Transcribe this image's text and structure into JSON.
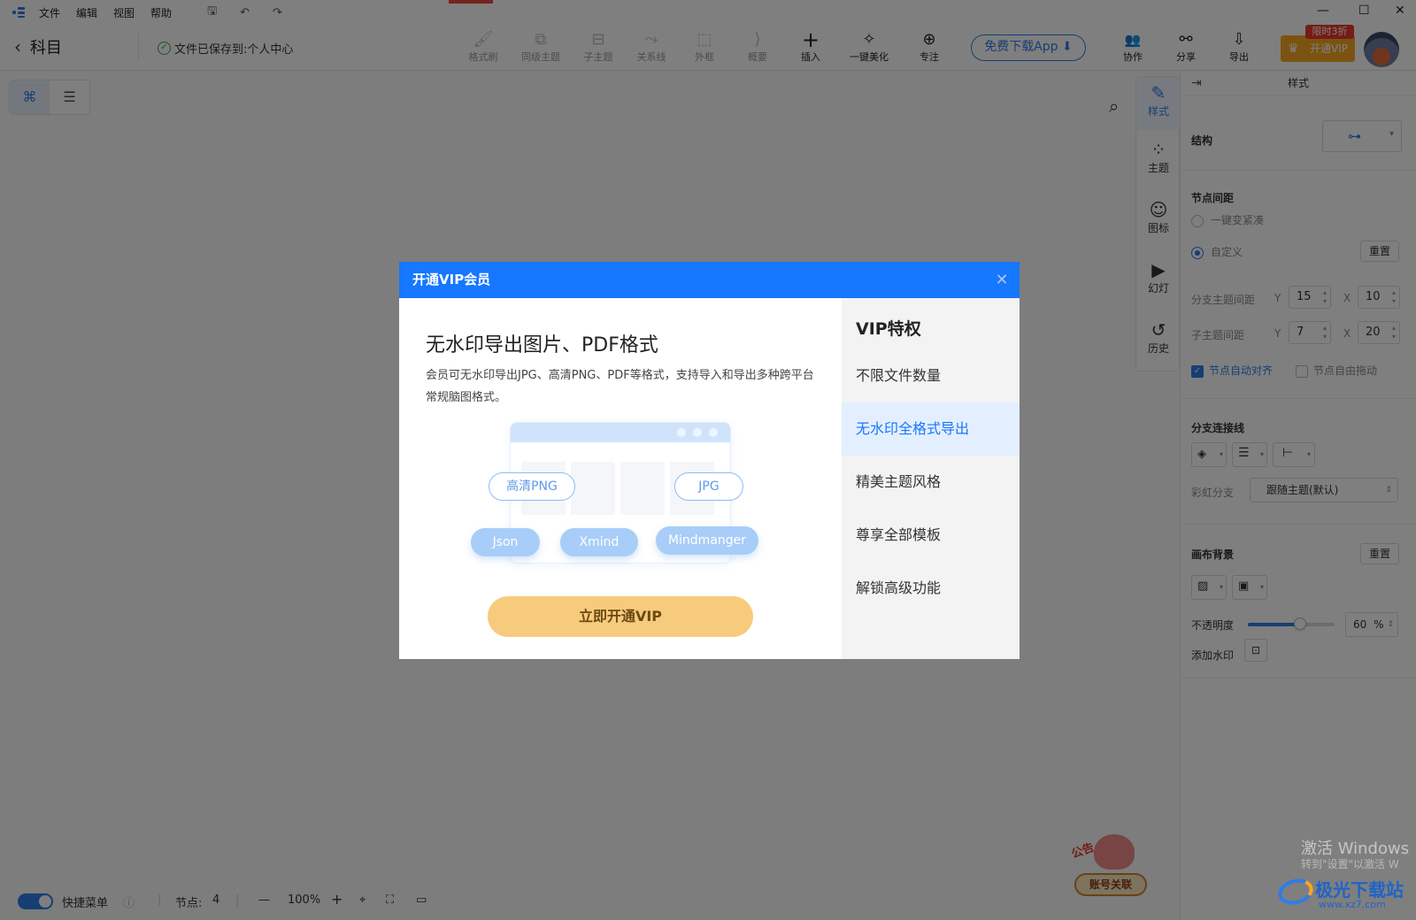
{
  "menu": {
    "items": [
      "文件",
      "编辑",
      "视图",
      "帮助"
    ]
  },
  "header": {
    "back_label": "科目",
    "saved_status": "文件已保存到:个人中心"
  },
  "toolbar": {
    "tools": [
      {
        "label": "格式刷",
        "icon": "format-brush-icon",
        "glyph": "🖌"
      },
      {
        "label": "同级主题",
        "icon": "sibling-topic-icon",
        "glyph": "⧉"
      },
      {
        "label": "子主题",
        "icon": "subtopic-icon",
        "glyph": "⊟"
      },
      {
        "label": "关系线",
        "icon": "relation-line-icon",
        "glyph": "⤳"
      },
      {
        "label": "外框",
        "icon": "boundary-icon",
        "glyph": "⬚"
      },
      {
        "label": "概要",
        "icon": "summary-icon",
        "glyph": "⟩"
      },
      {
        "label": "插入",
        "icon": "insert-icon",
        "glyph": "+"
      },
      {
        "label": "一键美化",
        "icon": "beautify-icon",
        "glyph": "✧"
      },
      {
        "label": "专注",
        "icon": "focus-icon",
        "glyph": "⊕"
      }
    ],
    "download_app": "免费下载App",
    "right_tools": [
      {
        "label": "协作",
        "icon": "collaborate-icon",
        "glyph": "👥"
      },
      {
        "label": "分享",
        "icon": "share-icon",
        "glyph": "⚯"
      },
      {
        "label": "导出",
        "icon": "export-icon",
        "glyph": "⇩"
      }
    ],
    "vip_button": "开通VIP",
    "vip_tag": "限时3折"
  },
  "side_tabs": [
    {
      "label": "样式",
      "icon": "style-icon",
      "glyph": "✎"
    },
    {
      "label": "主题",
      "icon": "theme-icon",
      "glyph": "⁘"
    },
    {
      "label": "图标",
      "icon": "sticker-icon",
      "glyph": "☺"
    },
    {
      "label": "幻灯",
      "icon": "slides-icon",
      "glyph": "▶"
    },
    {
      "label": "历史",
      "icon": "history-icon",
      "glyph": "↺"
    }
  ],
  "right_panel": {
    "title": "样式",
    "structure_label": "结构",
    "node_spacing": {
      "title": "节点间距",
      "option_compact": "一键变紧凑",
      "option_custom": "自定义",
      "reset": "重置",
      "branch_label": "分支主题间距",
      "branch_y": "15",
      "branch_x": "10",
      "child_label": "子主题间距",
      "child_y": "7",
      "child_x": "20",
      "axis_y": "Y",
      "axis_x": "X",
      "auto_align": "节点自动对齐",
      "free_drag": "节点自由拖动"
    },
    "branch_lines": {
      "title": "分支连接线",
      "rainbow_label": "彩虹分支",
      "rainbow_value": "跟随主题(默认)"
    },
    "canvas_bg": {
      "title": "画布背景",
      "reset": "重置",
      "opacity_label": "不透明度",
      "opacity_value": "60",
      "opacity_unit": "%",
      "opacity_fraction": 0.6,
      "watermark_label": "添加水印"
    }
  },
  "statusbar": {
    "quick_menu": "快捷菜单",
    "nodes_label": "节点:",
    "nodes_value": "4",
    "zoom": "100%"
  },
  "ad": {
    "stamp": "公告",
    "button": "账号关联"
  },
  "os_watermark": {
    "line1": "激活 Windows",
    "line2": "转到\"设置\"以激活 W"
  },
  "site_logo": {
    "name": "极光下载站",
    "url": "www.xz7.com"
  },
  "dialog": {
    "title": "开通VIP会员",
    "feature_title": "无水印导出图片、PDF格式",
    "feature_desc": "会员可无水印导出JPG、高清PNG、PDF等格式，支持导入和导出多种跨平台常规脑图格式。",
    "formats": [
      "高清PNG",
      "JPG",
      "Json",
      "Xmind",
      "Mindmanger"
    ],
    "cta": "立即开通VIP",
    "privileges_title": "VIP特权",
    "privileges": [
      "不限文件数量",
      "无水印全格式导出",
      "精美主题风格",
      "尊享全部模板",
      "解锁高级功能"
    ],
    "active_privilege_index": 1
  },
  "colors": {
    "accent": "#1677ff",
    "vip_gold": "#f7cb7c",
    "vip_orange": "#f6a623"
  }
}
